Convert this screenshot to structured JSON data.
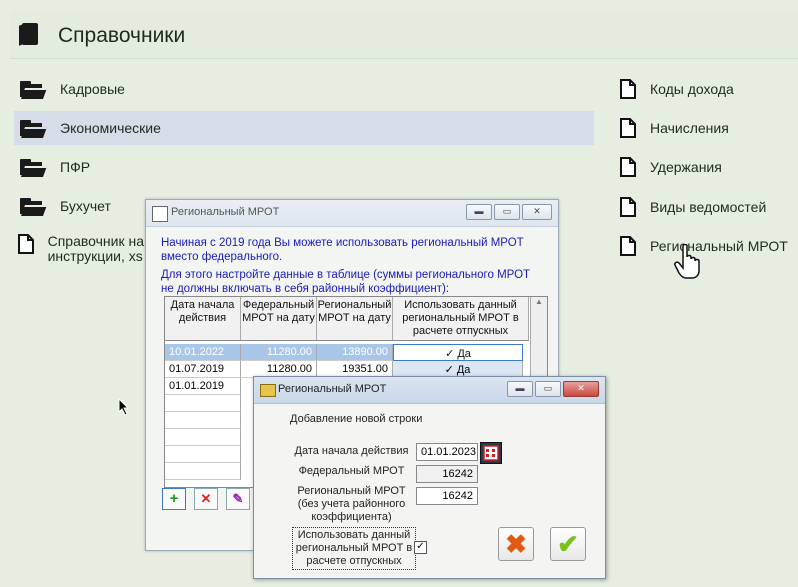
{
  "header": {
    "title": "Справочники"
  },
  "left_items": [
    {
      "label": "Кадровые"
    },
    {
      "label": "Экономические"
    },
    {
      "label": "ПФР"
    },
    {
      "label": "Бухучет"
    },
    {
      "label": "Справочник на\nинструкции, xs"
    }
  ],
  "right_items": [
    {
      "label": "Коды дохода"
    },
    {
      "label": "Начисления"
    },
    {
      "label": "Удержания"
    },
    {
      "label": "Виды ведомостей"
    },
    {
      "label": "Региональный МРОТ"
    }
  ],
  "win1": {
    "title": "Региональный МРОТ",
    "note1": "Начиная с 2019 года Вы можете использовать региональный МРОТ вместо федерального.",
    "note2": "Для этого настройте данные в таблице (суммы регионального МРОТ не должны включать в себя районный коэффициент):",
    "columns": [
      "Дата начала действия",
      "Федеральный МРОТ на дату",
      "Региональный МРОТ на дату",
      "Использовать данный региональный МРОТ в расчете отпускных"
    ],
    "rows": [
      {
        "date": "10.01.2022",
        "fed": "11280.00",
        "reg": "13890.00",
        "use": "Да"
      },
      {
        "date": "01.07.2019",
        "fed": "11280.00",
        "reg": "19351.00",
        "use": "Да"
      },
      {
        "date": "01.01.2019",
        "fed": "",
        "reg": "",
        "use": ""
      }
    ]
  },
  "win2": {
    "title": "Региональный МРОТ",
    "heading": "Добавление новой строки",
    "start_label": "Дата начала действия",
    "start_value": "01.01.2023",
    "fed_label": "Федеральный МРОТ",
    "fed_value": "16242",
    "reg_label": "Региональный МРОТ (без учета районного коэффициента)",
    "reg_value": "16242",
    "use_label": "Использовать данный региональный МРОТ в расчете отпускных"
  },
  "icons": {
    "cancel": "x-icon",
    "ok": "check-icon"
  },
  "colors": {
    "background": "#e6eee2",
    "selected": "#d6dde8",
    "note": "#1a1ac0"
  }
}
